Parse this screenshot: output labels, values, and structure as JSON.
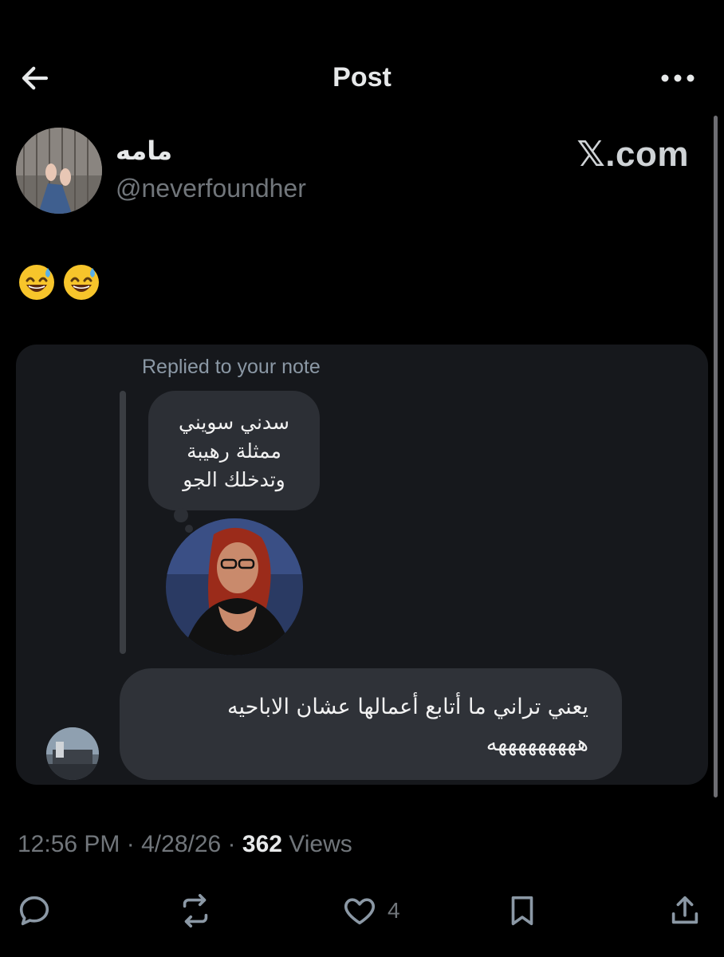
{
  "header": {
    "title": "Post",
    "back_icon": "arrow-left-icon",
    "more_icon": "more-horizontal-icon"
  },
  "post": {
    "author_name": "مامه",
    "author_handle": "@neverfoundher",
    "watermark": "𝕏.com",
    "text": "😅😅"
  },
  "card": {
    "label": "Replied to your note",
    "note_text": "سدني سويني\nممثلة رهيبة\nوتدخلك الجو",
    "reply_text": "يعني تراني ما أتابع أعمالها عشان الاباحيه\nهههههههههه"
  },
  "meta": {
    "time": "12:56 PM",
    "date": "4/28/26",
    "views_count": "362",
    "views_label": "Views",
    "separator": "·"
  },
  "actions": {
    "reply_icon": "comment-icon",
    "repost_icon": "repost-icon",
    "like_icon": "heart-icon",
    "like_count": "4",
    "bookmark_icon": "bookmark-icon",
    "share_icon": "share-icon"
  },
  "colors": {
    "background": "#000000",
    "text": "#e7e9ea",
    "secondary": "#71767b",
    "card": "#16181c",
    "bubble": "#2f3238"
  }
}
